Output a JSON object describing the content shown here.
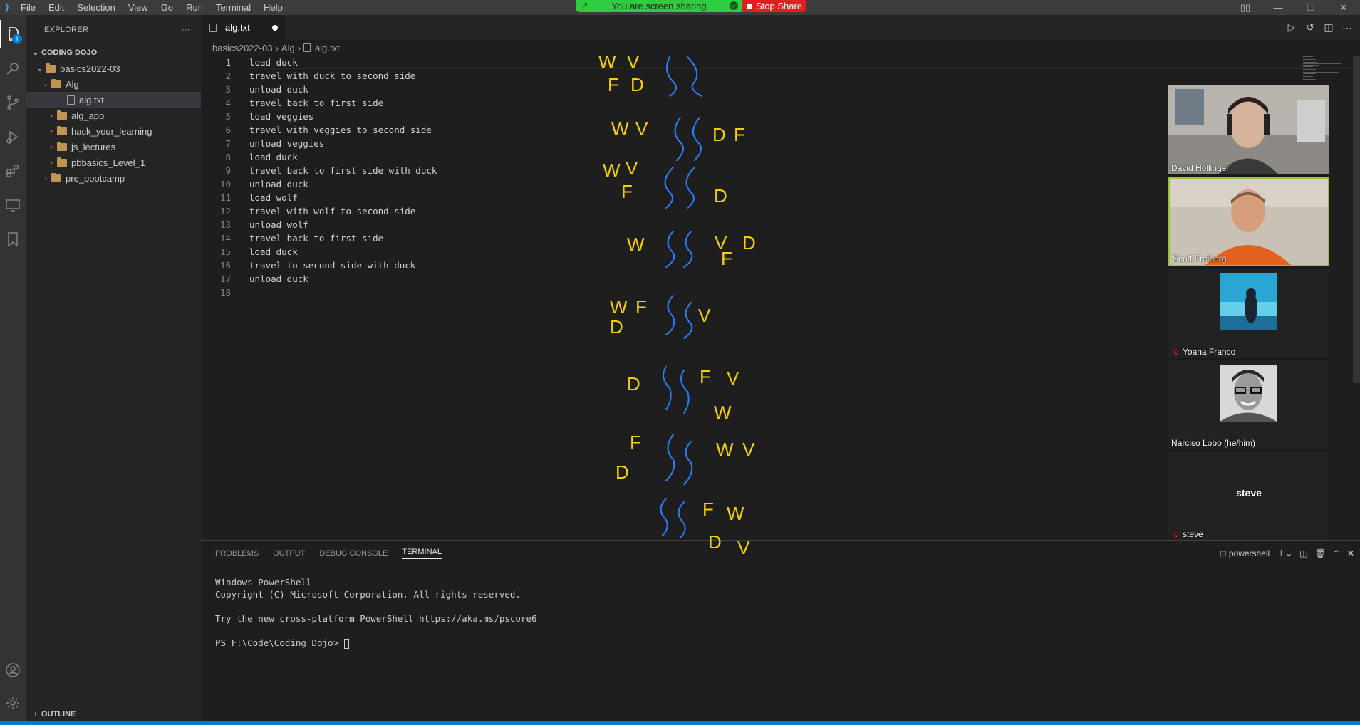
{
  "menu": [
    "File",
    "Edit",
    "Selection",
    "View",
    "Go",
    "Run",
    "Terminal",
    "Help"
  ],
  "share": {
    "status": "You are screen sharing",
    "stop_label": "Stop Share"
  },
  "activity": {
    "explorer_badge": "1"
  },
  "sidebar": {
    "title": "EXPLORER",
    "more": "···",
    "workspace": "CODING DOJO",
    "tree": [
      {
        "label": "basics2022-03"
      },
      {
        "label": "Alg"
      },
      {
        "label": "alg.txt"
      },
      {
        "label": "alg_app"
      },
      {
        "label": "hack_your_learning"
      },
      {
        "label": "js_lectures"
      },
      {
        "label": "pbbasics_Level_1"
      },
      {
        "label": "pre_bootcamp"
      }
    ],
    "outline": "OUTLINE"
  },
  "editor": {
    "tab_label": "alg.txt",
    "breadcrumb": [
      "basics2022-03",
      "Alg",
      "alg.txt"
    ],
    "lines": [
      "load duck",
      "travel with duck to second side",
      "unload duck",
      "travel back to first side",
      "load veggies",
      "travel with veggies to second side",
      "unload veggies",
      "load duck",
      "travel back to first side with duck",
      "unload duck",
      "load wolf",
      "travel with wolf to second side",
      "unload wolf",
      "travel back to first side",
      "load duck",
      "travel to second side with duck",
      "unload duck",
      ""
    ],
    "line_numbers": [
      "1",
      "2",
      "3",
      "4",
      "5",
      "6",
      "7",
      "8",
      "9",
      "10",
      "11",
      "12",
      "13",
      "14",
      "15",
      "16",
      "17",
      "18"
    ]
  },
  "participants": [
    {
      "name": "David Hollinger",
      "muted": false
    },
    {
      "name": "Scott Freiberg",
      "muted": false
    },
    {
      "name": "Yoana Franco",
      "muted": true
    },
    {
      "name": "Narciso Lobo (he/him)",
      "muted": false
    },
    {
      "name": "steve",
      "muted": true,
      "center_label": "steve"
    }
  ],
  "panel": {
    "tabs": [
      "PROBLEMS",
      "OUTPUT",
      "DEBUG CONSOLE",
      "TERMINAL"
    ],
    "terminal_name": "powershell",
    "terminal_lines": [
      "Windows PowerShell",
      "Copyright (C) Microsoft Corporation. All rights reserved.",
      "",
      "Try the new cross-platform PowerShell https://aka.ms/pscore6",
      "",
      "PS F:\\Code\\Coding Dojo> "
    ]
  },
  "colors": {
    "accent": "#007acc",
    "ink_yellow": "#f5d000",
    "ink_blue": "#2a7fff",
    "share_green": "#2ecc40",
    "share_red": "#e02020"
  },
  "annotation_labels": [
    "W",
    "V",
    "F",
    "D",
    "W",
    "V",
    "D",
    "F",
    "W",
    "V",
    "F",
    "D",
    "W",
    "V",
    "D",
    "F",
    "W",
    "F",
    "D",
    "V",
    "D",
    "F",
    "V",
    "W",
    "F",
    "D",
    "W",
    "V",
    "F",
    "W",
    "D",
    "V"
  ]
}
